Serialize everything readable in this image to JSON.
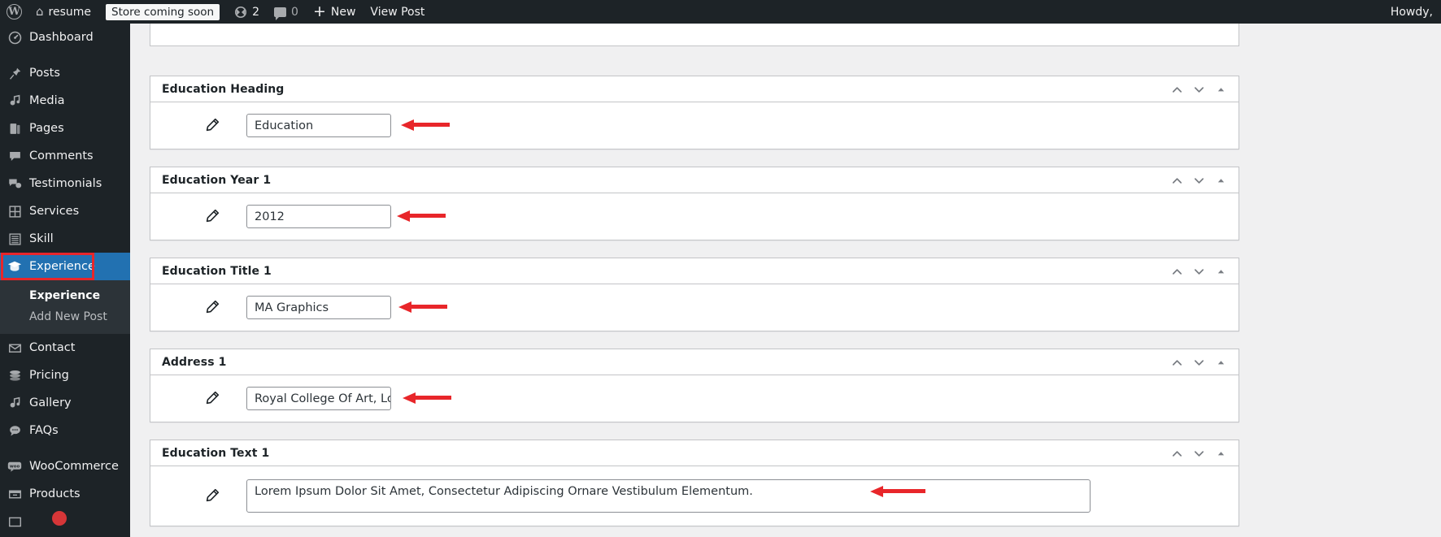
{
  "adminbar": {
    "wp_logo": "W",
    "home_icon": "home-icon",
    "site_name": "resume",
    "coming_soon_label": "Store coming soon",
    "updates_count": "2",
    "comments_count": "0",
    "new_label": "New",
    "view_post_label": "View Post",
    "howdy_label": "Howdy,"
  },
  "sidebar": {
    "items": [
      {
        "label": "Dashboard",
        "icon": "dashboard-icon"
      },
      {
        "label": "Posts",
        "icon": "pin-icon"
      },
      {
        "label": "Media",
        "icon": "media-icon"
      },
      {
        "label": "Pages",
        "icon": "page-icon"
      },
      {
        "label": "Comments",
        "icon": "comment-icon"
      },
      {
        "label": "Testimonials",
        "icon": "testimonial-icon"
      },
      {
        "label": "Services",
        "icon": "grid-icon"
      },
      {
        "label": "Skill",
        "icon": "list-icon"
      },
      {
        "label": "Experience",
        "icon": "graduation-cap-icon"
      },
      {
        "label": "Contact",
        "icon": "envelope-icon"
      },
      {
        "label": "Pricing",
        "icon": "coins-icon"
      },
      {
        "label": "Gallery",
        "icon": "media-icon"
      },
      {
        "label": "FAQs",
        "icon": "chat-icon"
      },
      {
        "label": "WooCommerce",
        "icon": "woo-icon"
      },
      {
        "label": "Products",
        "icon": "products-icon"
      }
    ],
    "submenu": [
      {
        "label": "Experience",
        "current": true
      },
      {
        "label": "Add New Post",
        "current": false
      }
    ],
    "current_item": "Experience"
  },
  "panels": [
    {
      "title": "Education Heading",
      "value": "Education",
      "field_size": "small",
      "icon": "pencil-icon"
    },
    {
      "title": "Education Year 1",
      "value": "2012",
      "field_size": "small",
      "icon": "pencil-icon"
    },
    {
      "title": "Education Title 1",
      "value": "MA Graphics",
      "field_size": "small",
      "icon": "pencil-icon"
    },
    {
      "title": "Address 1",
      "value": "Royal College Of Art, London",
      "field_size": "small",
      "icon": "pencil-icon"
    },
    {
      "title": "Education Text 1",
      "value": "Lorem Ipsum Dolor Sit Amet, Consectetur Adipiscing Ornare Vestibulum Elementum.",
      "field_size": "wide",
      "icon": "pencil-icon"
    }
  ],
  "panel_controls": {
    "move_up": "chevron-up-icon",
    "move_down": "chevron-down-icon",
    "toggle": "caret-up-icon"
  },
  "colors": {
    "accent_blue": "#2271b1",
    "annotation_red": "#e8262a",
    "admin_dark": "#1d2327",
    "submenu_dark": "#2c3338",
    "badge_red": "#d63638"
  }
}
